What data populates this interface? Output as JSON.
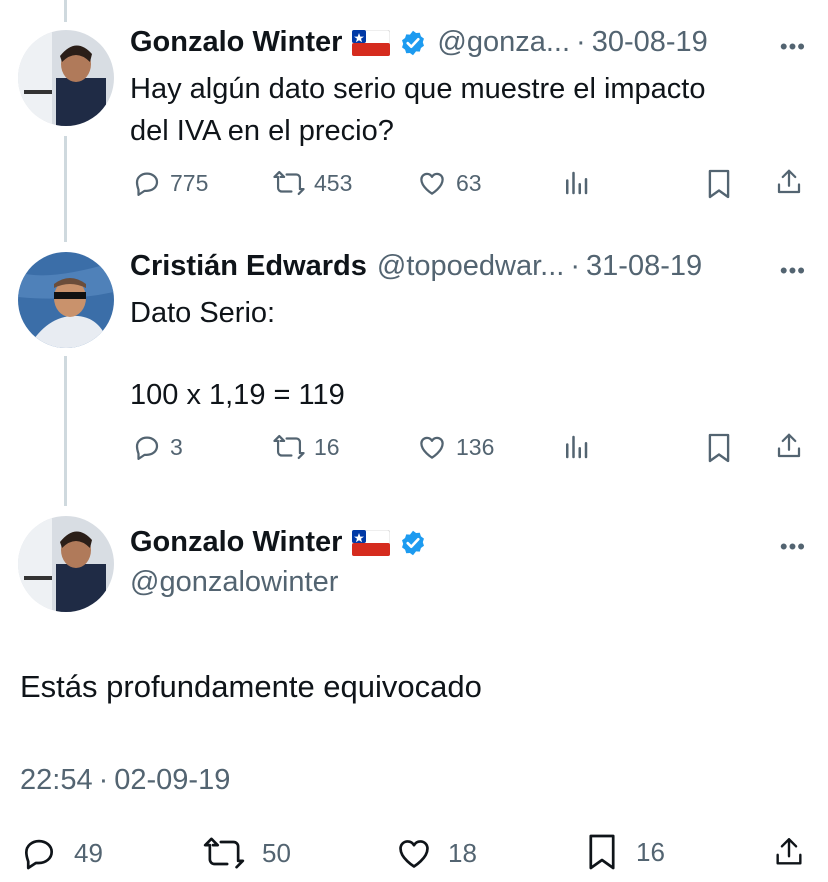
{
  "tweets": [
    {
      "name": "Gonzalo Winter",
      "handle": "@gonza...",
      "date": "30-08-19",
      "text_lines": [
        "Hay algún dato serio que muestre el impacto",
        "del IVA en el precio?"
      ],
      "replies": "775",
      "retweets": "453",
      "likes": "63"
    },
    {
      "name": "Cristián Edwards",
      "handle": "@topoedwar...",
      "date": "31-08-19",
      "text_lines": [
        "Dato Serio:",
        "100 x 1,19 = 119"
      ],
      "replies": "3",
      "retweets": "16",
      "likes": "136"
    }
  ],
  "main_tweet": {
    "name": "Gonzalo Winter",
    "handle": "@gonzalowinter",
    "text": "Estás profundamente equivocado",
    "time": "22:54",
    "date": "02-09-19",
    "replies": "49",
    "retweets": "50",
    "likes": "18",
    "bookmarks": "16"
  },
  "separator": "·",
  "more_label": "•••",
  "colors": {
    "verified": "#1d9bf0",
    "secondary_text": "#536471",
    "thread_line": "#cfd9de"
  }
}
